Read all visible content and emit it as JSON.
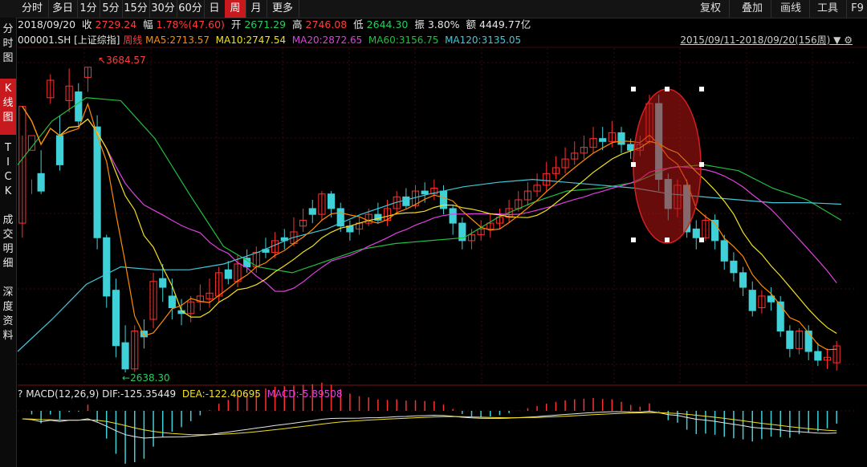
{
  "toolbar": {
    "periods": [
      "分时",
      "多日",
      "1分",
      "5分",
      "15分",
      "30分",
      "60分",
      "日",
      "周",
      "月",
      "更多"
    ],
    "active_period": "周",
    "right_buttons": [
      "复权",
      "叠加",
      "画线",
      "工具"
    ],
    "f9": "F9"
  },
  "sidebar": {
    "items": [
      "分\n时\n图",
      "K\n线\n图",
      "T\nI\nC\nK",
      "成\n交\n明\n细",
      "深\n度\n资\n料"
    ],
    "active": "K\n线\n图"
  },
  "quote": {
    "date": "2018/09/20",
    "close_label": "收",
    "close": "2729.24",
    "change_label": "幅",
    "change": "1.78%(47.60)",
    "open_label": "开",
    "open": "2671.29",
    "high_label": "高",
    "high": "2746.08",
    "low_label": "低",
    "low": "2644.30",
    "amp_label": "振",
    "amplitude": "3.80%",
    "amount_label": "额",
    "amount": "4449.77亿"
  },
  "indicators": {
    "symbol": "000001.SH [上证综指]",
    "type": "周线",
    "ma5": "MA5:2713.57",
    "ma10": "MA10:2747.54",
    "ma20": "MA20:2872.65",
    "ma60": "MA60:3156.75",
    "ma120": "MA120:3135.05",
    "range": "2015/09/11-2018/09/20(156周)"
  },
  "markers": {
    "high": "3684.57",
    "low": "2638.30"
  },
  "macd": {
    "label": "MACD(12,26,9)",
    "dif": "DIF:-125.35449",
    "dea": "DEA:-122.40695",
    "macd": "MACD:-5.89508"
  },
  "chart_data": {
    "type": "candlestick",
    "frequency": "weekly",
    "symbol": "000001.SH",
    "start": "2015/09/11",
    "end": "2018/09/20",
    "ylim": [
      2600,
      3750
    ],
    "colors": {
      "up": "#ff3030",
      "down": "#40d0d8",
      "ma5": "#ff8c00",
      "ma10": "#f2e020",
      "ma20": "#e040e0",
      "ma60": "#20c040",
      "ma120": "#40c8d8",
      "grid": "#3a0a0a"
    },
    "series": [
      {
        "name": "MA60",
        "values": [
          3350,
          3500,
          3580,
          3570,
          3440,
          3250,
          3070,
          3000,
          2980,
          3020,
          3060,
          3080,
          3090,
          3100,
          3170,
          3220,
          3260,
          3270,
          3290,
          3340,
          3350,
          3330,
          3270,
          3230,
          3160
        ]
      },
      {
        "name": "MA120",
        "values": [
          2710,
          2820,
          2940,
          3000,
          2990,
          2990,
          3010,
          3050,
          3100,
          3130,
          3180,
          3220,
          3250,
          3275,
          3290,
          3300,
          3290,
          3280,
          3270,
          3250,
          3240,
          3230,
          3220,
          3220,
          3215
        ]
      }
    ],
    "candles": [
      [
        3150,
        3550,
        3450,
        3100
      ],
      [
        3400,
        3450,
        3300,
        3250
      ],
      [
        3320,
        3260,
        3400,
        3250
      ],
      [
        3580,
        3640,
        3660,
        3560
      ],
      [
        3450,
        3350,
        3520,
        3330
      ],
      [
        3570,
        3620,
        3680,
        3530
      ],
      [
        3600,
        3500,
        3630,
        3480
      ],
      [
        3650,
        3684.57,
        3684.57,
        3600
      ],
      [
        3480,
        3100,
        3520,
        3060
      ],
      [
        3100,
        2900,
        3110,
        2860
      ],
      [
        2920,
        2730,
        2960,
        2690
      ],
      [
        2740,
        2650,
        2800,
        2638.3
      ],
      [
        2650,
        2780,
        2800,
        2640
      ],
      [
        2780,
        2760,
        2820,
        2720
      ],
      [
        2820,
        2950,
        2980,
        2790
      ],
      [
        2960,
        2930,
        3010,
        2880
      ],
      [
        2900,
        2860,
        2960,
        2820
      ],
      [
        2850,
        2840,
        2890,
        2800
      ],
      [
        2840,
        2880,
        2900,
        2810
      ],
      [
        2880,
        2900,
        2940,
        2850
      ],
      [
        2890,
        2910,
        2960,
        2860
      ],
      [
        2900,
        2980,
        3000,
        2880
      ],
      [
        2990,
        2960,
        3020,
        2940
      ],
      [
        2950,
        3010,
        3040,
        2930
      ],
      [
        3030,
        3000,
        3060,
        2980
      ],
      [
        3000,
        3050,
        3070,
        2980
      ],
      [
        3060,
        3050,
        3100,
        3030
      ],
      [
        3050,
        3090,
        3120,
        3030
      ],
      [
        3100,
        3090,
        3130,
        3060
      ],
      [
        3080,
        3120,
        3170,
        3070
      ],
      [
        3140,
        3160,
        3200,
        3120
      ],
      [
        3200,
        3180,
        3230,
        3150
      ],
      [
        3180,
        3250,
        3260,
        3160
      ],
      [
        3250,
        3200,
        3260,
        3170
      ],
      [
        3200,
        3140,
        3220,
        3120
      ],
      [
        3140,
        3120,
        3160,
        3090
      ],
      [
        3130,
        3150,
        3170,
        3110
      ],
      [
        3150,
        3180,
        3200,
        3140
      ],
      [
        3180,
        3160,
        3220,
        3150
      ],
      [
        3160,
        3200,
        3230,
        3140
      ],
      [
        3200,
        3240,
        3260,
        3180
      ],
      [
        3240,
        3210,
        3270,
        3200
      ],
      [
        3210,
        3260,
        3280,
        3200
      ],
      [
        3260,
        3250,
        3290,
        3220
      ],
      [
        3250,
        3270,
        3300,
        3230
      ],
      [
        3260,
        3200,
        3280,
        3180
      ],
      [
        3200,
        3150,
        3210,
        3110
      ],
      [
        3150,
        3090,
        3170,
        3060
      ],
      [
        3090,
        3110,
        3130,
        3060
      ],
      [
        3110,
        3130,
        3160,
        3090
      ],
      [
        3130,
        3150,
        3180,
        3100
      ],
      [
        3150,
        3170,
        3200,
        3130
      ],
      [
        3170,
        3200,
        3230,
        3150
      ],
      [
        3200,
        3230,
        3260,
        3190
      ],
      [
        3230,
        3260,
        3290,
        3210
      ],
      [
        3260,
        3280,
        3320,
        3240
      ],
      [
        3280,
        3320,
        3360,
        3260
      ],
      [
        3320,
        3340,
        3380,
        3300
      ],
      [
        3340,
        3370,
        3410,
        3320
      ],
      [
        3370,
        3390,
        3430,
        3350
      ],
      [
        3390,
        3410,
        3450,
        3370
      ],
      [
        3410,
        3440,
        3480,
        3390
      ],
      [
        3440,
        3430,
        3480,
        3400
      ],
      [
        3430,
        3460,
        3500,
        3410
      ],
      [
        3460,
        3420,
        3480,
        3390
      ],
      [
        3420,
        3400,
        3440,
        3370
      ],
      [
        3400,
        3420,
        3450,
        3380
      ],
      [
        3430,
        3560,
        3590,
        3420
      ],
      [
        3560,
        3300,
        3590,
        3260
      ],
      [
        3300,
        3200,
        3320,
        3160
      ],
      [
        3200,
        3280,
        3300,
        3170
      ],
      [
        3280,
        3120,
        3300,
        3100
      ],
      [
        3130,
        3100,
        3160,
        3060
      ],
      [
        3100,
        3160,
        3180,
        3090
      ],
      [
        3160,
        3090,
        3180,
        3060
      ],
      [
        3090,
        3020,
        3110,
        2990
      ],
      [
        3020,
        2980,
        3050,
        2950
      ],
      [
        2980,
        2930,
        3000,
        2900
      ],
      [
        2920,
        2850,
        2950,
        2830
      ],
      [
        2860,
        2900,
        2920,
        2840
      ],
      [
        2900,
        2880,
        2930,
        2850
      ],
      [
        2880,
        2780,
        2900,
        2760
      ],
      [
        2780,
        2720,
        2800,
        2690
      ],
      [
        2720,
        2780,
        2790,
        2700
      ],
      [
        2780,
        2710,
        2800,
        2680
      ],
      [
        2710,
        2680,
        2740,
        2660
      ],
      [
        2680,
        2690,
        2720,
        2650
      ],
      [
        2671.29,
        2729.24,
        2746.08,
        2644.3
      ]
    ]
  }
}
